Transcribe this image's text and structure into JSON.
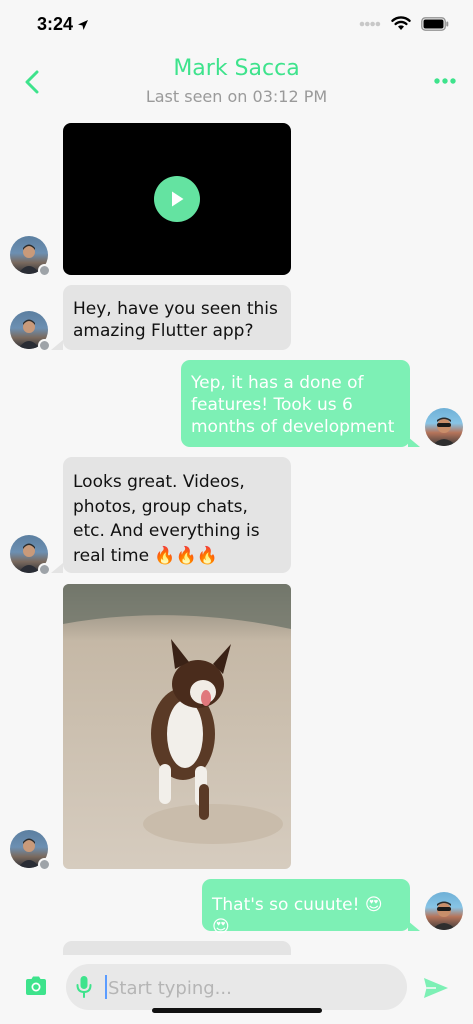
{
  "status_bar": {
    "time": "3:24"
  },
  "header": {
    "title": "Mark Sacca",
    "subtitle": "Last seen on 03:12 PM"
  },
  "messages": [
    {
      "side": "incoming",
      "type": "video"
    },
    {
      "side": "incoming",
      "type": "text",
      "lines": [
        "Hey, have you seen this",
        "amazing Flutter app?"
      ]
    },
    {
      "side": "outgoing",
      "type": "text",
      "lines": [
        "Yep, it has a done of",
        "features! Took us 6",
        "months of development"
      ]
    },
    {
      "side": "incoming",
      "type": "text",
      "lines": [
        "Looks great. Videos,",
        "photos, group chats,",
        "etc. And everything is",
        "real time 🔥🔥🔥"
      ]
    },
    {
      "side": "incoming",
      "type": "image",
      "subject": "dog"
    },
    {
      "side": "outgoing",
      "type": "text",
      "lines": [
        "That's so cuuute! 😍😍"
      ]
    }
  ],
  "composer": {
    "placeholder": "Start typing..."
  },
  "colors": {
    "accent": "#3ee38c",
    "outgoing_bubble": "#7df0b5",
    "incoming_bubble": "#e4e4e4",
    "background": "#f7f7f7"
  },
  "icons": {
    "back": "chevron-left-icon",
    "more": "more-dots-icon",
    "camera": "camera-icon",
    "mic": "microphone-icon",
    "send": "send-icon",
    "play": "play-icon"
  }
}
